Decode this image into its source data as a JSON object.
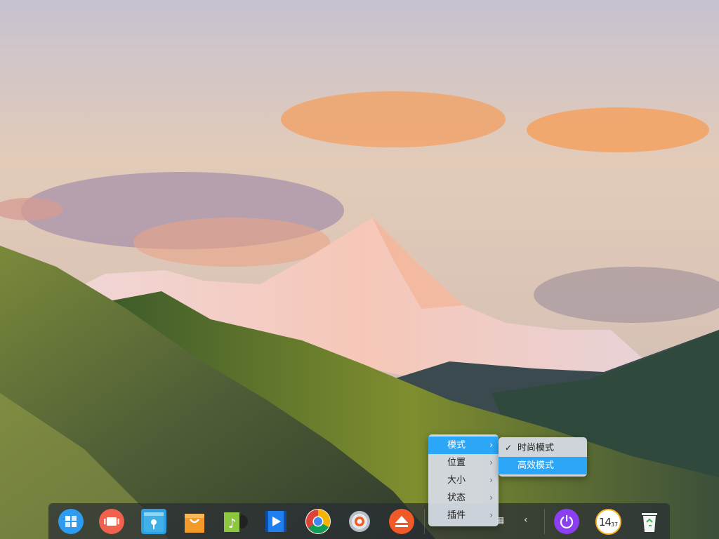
{
  "wallpaper": {
    "description_icon": "mountain-landscape"
  },
  "dock": {
    "apps": [
      {
        "name": "launcher",
        "icon": "grid-icon",
        "color": "#2d9cf0"
      },
      {
        "name": "multitasking",
        "icon": "multitask-icon",
        "color": "#f0624d"
      },
      {
        "name": "file-manager",
        "icon": "folder-icon",
        "color": "#2ea0e0"
      },
      {
        "name": "app-store",
        "icon": "shopping-bag-icon",
        "color": "#f49a2a"
      },
      {
        "name": "music",
        "icon": "music-icon",
        "color": "#8dc63f"
      },
      {
        "name": "video",
        "icon": "video-icon",
        "color": "#1f7ff0"
      },
      {
        "name": "chrome",
        "icon": "chrome-icon",
        "color": "#db4437"
      },
      {
        "name": "settings",
        "icon": "gear-icon",
        "color": "#9aa3ad"
      },
      {
        "name": "installer",
        "icon": "eject-icon",
        "color": "#f05a28"
      }
    ],
    "tray": {
      "power": {
        "icon": "power-icon",
        "color": "#8a3ff0"
      },
      "clock": {
        "hour": "14",
        "minute": "37"
      },
      "trash": {
        "icon": "trash-icon"
      }
    }
  },
  "context_menu": {
    "items": [
      {
        "label": "模式",
        "has_submenu": true,
        "active": true
      },
      {
        "label": "位置",
        "has_submenu": true,
        "active": false
      },
      {
        "label": "大小",
        "has_submenu": true,
        "active": false
      },
      {
        "label": "状态",
        "has_submenu": true,
        "active": false
      },
      {
        "label": "插件",
        "has_submenu": true,
        "active": false
      }
    ]
  },
  "submenu": {
    "items": [
      {
        "label": "时尚模式",
        "checked": true,
        "active": false
      },
      {
        "label": "高效模式",
        "checked": false,
        "active": true
      }
    ]
  }
}
